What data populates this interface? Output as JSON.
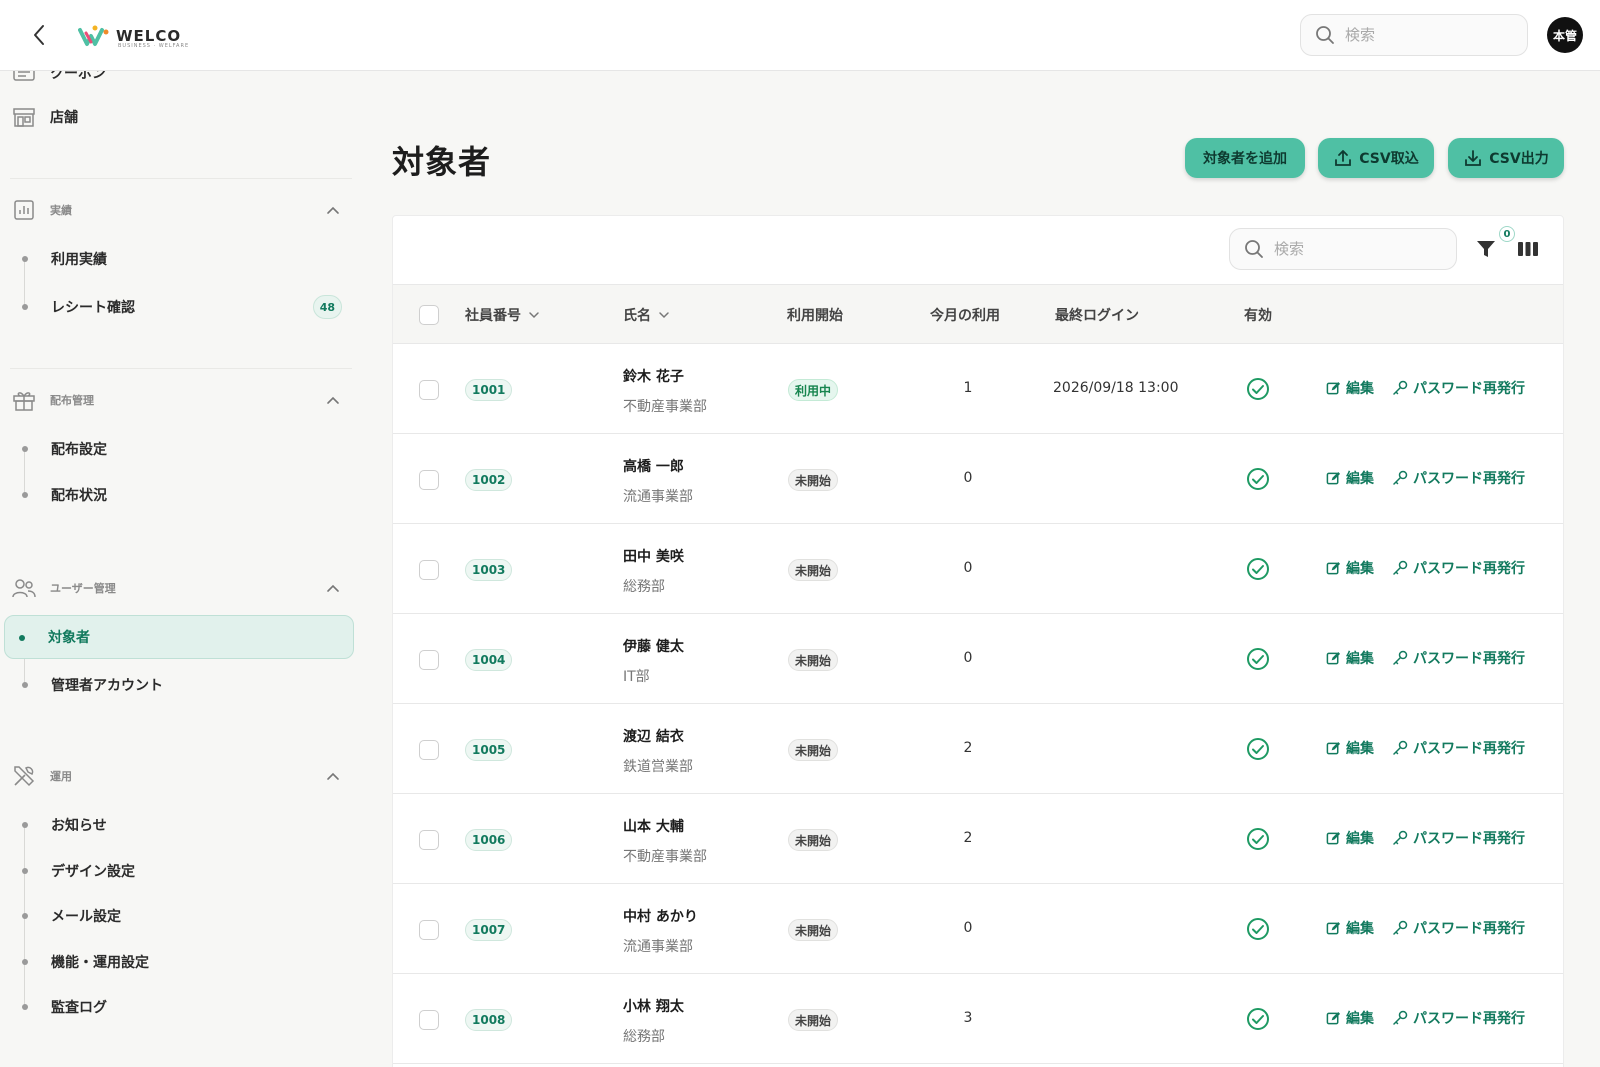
{
  "header": {
    "brand": "WELCO",
    "brand_sub": "BUSINESS · WELFARE",
    "search_placeholder": "検索",
    "avatar_text": "本管"
  },
  "sidebar": {
    "coupon_label": "クーポン",
    "store_label": "店舗",
    "sections": [
      {
        "title": "実績",
        "items": [
          {
            "label": "利用実績"
          },
          {
            "label": "レシート確認",
            "badge": "48"
          }
        ]
      },
      {
        "title": "配布管理",
        "items": [
          {
            "label": "配布設定"
          },
          {
            "label": "配布状況"
          }
        ]
      },
      {
        "title": "ユーザー管理",
        "items": [
          {
            "label": "対象者",
            "active": true
          },
          {
            "label": "管理者アカウント"
          }
        ]
      },
      {
        "title": "運用",
        "items": [
          {
            "label": "お知らせ"
          },
          {
            "label": "デザイン設定"
          },
          {
            "label": "メール設定"
          },
          {
            "label": "機能・運用設定"
          },
          {
            "label": "監査ログ"
          }
        ]
      }
    ]
  },
  "main": {
    "title": "対象者",
    "buttons": {
      "add": "対象者を追加",
      "import": "CSV取込",
      "export": "CSV出力"
    },
    "table_search_placeholder": "検索",
    "filter_count": "0",
    "columns": {
      "emp_no": "社員番号",
      "name": "氏名",
      "status": "利用開始",
      "usage": "今月の利用",
      "last_login": "最終ログイン",
      "valid": "有効"
    },
    "actions": {
      "edit": "編集",
      "reset_password": "パスワード再発行"
    },
    "rows": [
      {
        "emp_no": "1001",
        "name": "鈴木 花子",
        "dept": "不動産事業部",
        "status": "利用中",
        "status_type": "active",
        "usage": "1",
        "last_login": "2026/09/18 13:00"
      },
      {
        "emp_no": "1002",
        "name": "高橋 一郎",
        "dept": "流通事業部",
        "status": "未開始",
        "status_type": "inactive",
        "usage": "0",
        "last_login": ""
      },
      {
        "emp_no": "1003",
        "name": "田中 美咲",
        "dept": "総務部",
        "status": "未開始",
        "status_type": "inactive",
        "usage": "0",
        "last_login": ""
      },
      {
        "emp_no": "1004",
        "name": "伊藤 健太",
        "dept": "IT部",
        "status": "未開始",
        "status_type": "inactive",
        "usage": "0",
        "last_login": ""
      },
      {
        "emp_no": "1005",
        "name": "渡辺 結衣",
        "dept": "鉄道営業部",
        "status": "未開始",
        "status_type": "inactive",
        "usage": "2",
        "last_login": ""
      },
      {
        "emp_no": "1006",
        "name": "山本 大輔",
        "dept": "不動産事業部",
        "status": "未開始",
        "status_type": "inactive",
        "usage": "2",
        "last_login": ""
      },
      {
        "emp_no": "1007",
        "name": "中村 あかり",
        "dept": "流通事業部",
        "status": "未開始",
        "status_type": "inactive",
        "usage": "0",
        "last_login": ""
      },
      {
        "emp_no": "1008",
        "name": "小林 翔太",
        "dept": "総務部",
        "status": "未開始",
        "status_type": "inactive",
        "usage": "3",
        "last_login": ""
      }
    ]
  },
  "colors": {
    "accent": "#4fc0a4",
    "accent_dark": "#127a5e",
    "valid_check": "#1e9a63"
  }
}
